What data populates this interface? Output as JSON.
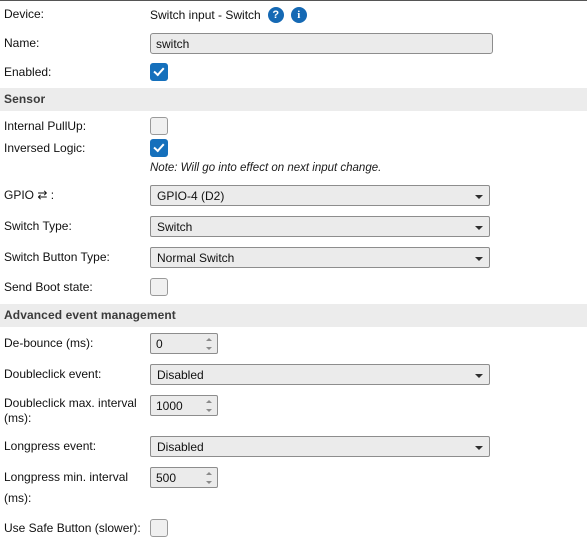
{
  "form": {
    "device": {
      "label": "Device:",
      "value": "Switch input - Switch",
      "help_icon": "?",
      "info_icon": "i",
      "badge_color": "#1569b4"
    },
    "name": {
      "label": "Name:",
      "value": "switch",
      "placeholder": ""
    },
    "enabled": {
      "label": "Enabled:",
      "checked": true
    }
  },
  "sensor_section": {
    "title": "Sensor",
    "internal_pullup": {
      "label": "Internal PullUp:",
      "checked": false
    },
    "inversed_logic": {
      "label": "Inversed Logic:",
      "checked": true
    },
    "note": "Note: Will go into effect on next input change.",
    "gpio": {
      "label": "GPIO ⇄ :",
      "value": "GPIO-4 (D2)"
    },
    "switch_type": {
      "label": "Switch Type:",
      "value": "Switch"
    },
    "switch_button_type": {
      "label": "Switch Button Type:",
      "value": "Normal Switch"
    },
    "send_boot_state": {
      "label": "Send Boot state:",
      "checked": false
    }
  },
  "advanced_section": {
    "title": "Advanced event management",
    "debounce": {
      "label": "De-bounce (ms):",
      "value": "0"
    },
    "doubleclick_event": {
      "label": "Doubleclick event:",
      "value": "Disabled"
    },
    "doubleclick_interval": {
      "label": "Doubleclick max. interval (ms):",
      "value": "1000"
    },
    "longpress_event": {
      "label": "Longpress event:",
      "value": "Disabled"
    },
    "longpress_interval": {
      "label": "Longpress min. interval (ms):",
      "value": "500"
    },
    "safe_button": {
      "label": "Use Safe Button (slower):",
      "checked": false
    }
  }
}
